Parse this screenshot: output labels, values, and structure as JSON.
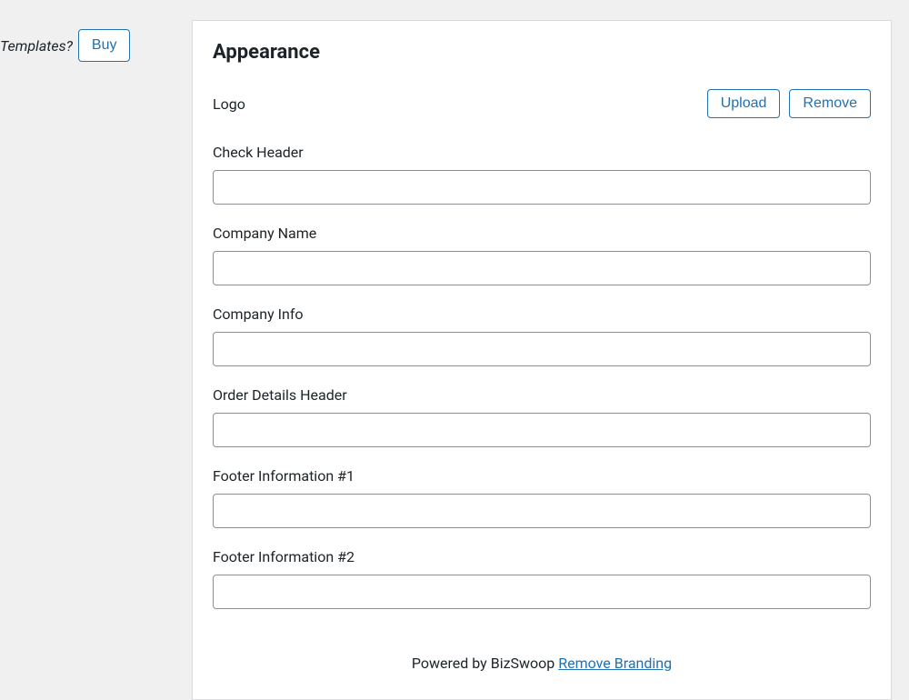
{
  "sidebar": {
    "templates_label": "Templates?",
    "buy_label": "Buy"
  },
  "appearance": {
    "title": "Appearance",
    "logo_label": "Logo",
    "upload_label": "Upload",
    "remove_label": "Remove",
    "fields": {
      "check_header": {
        "label": "Check Header",
        "value": ""
      },
      "company_name": {
        "label": "Company Name",
        "value": ""
      },
      "company_info": {
        "label": "Company Info",
        "value": ""
      },
      "order_details_header": {
        "label": "Order Details Header",
        "value": ""
      },
      "footer_info_1": {
        "label": "Footer Information #1",
        "value": ""
      },
      "footer_info_2": {
        "label": "Footer Information #2",
        "value": ""
      }
    }
  },
  "footer": {
    "powered_by": "Powered by BizSwoop ",
    "remove_branding": "Remove Branding"
  }
}
